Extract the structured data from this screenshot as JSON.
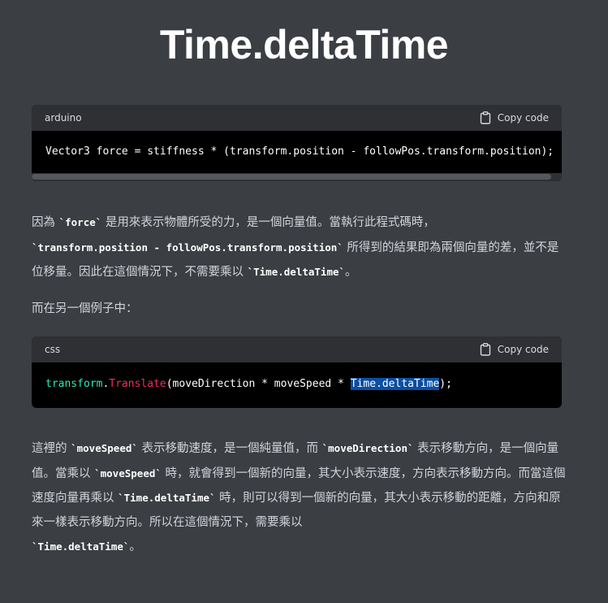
{
  "title": "Time.deltaTime",
  "code_blocks": [
    {
      "language": "arduino",
      "copy_label": "Copy code",
      "code": "Vector3 force = stiffness * (transform.position - followPos.transform.position);"
    },
    {
      "language": "css",
      "copy_label": "Copy code",
      "tokens": {
        "obj": "transform",
        "dot": ".",
        "method": "Translate",
        "args": "(moveDirection * moveSpeed * ",
        "selected": "Time.deltaTime",
        "end": ");"
      }
    }
  ],
  "paragraphs": [
    [
      {
        "t": "因為 "
      },
      {
        "c": "`force`"
      },
      {
        "t": " 是用來表示物體所受的力，是一個向量值。當執行此程式碼時，"
      },
      {
        "br": true
      },
      {
        "c": "`transform.position - followPos.transform.position`"
      },
      {
        "t": " 所得到的結果即為兩個向量的差，並不是位移量。因此在這個情況下，不需要乘以 "
      },
      {
        "c": "`Time.deltaTime`"
      },
      {
        "t": "。"
      }
    ],
    [
      {
        "t": "而在另一個例子中："
      }
    ],
    [
      {
        "t": "這裡的 "
      },
      {
        "c": "`moveSpeed`"
      },
      {
        "t": " 表示移動速度，是一個純量值，而 "
      },
      {
        "c": "`moveDirection`"
      },
      {
        "t": " 表示移動方向，是一個向量值。當乘以 "
      },
      {
        "c": "`moveSpeed`"
      },
      {
        "t": " 時，就會得到一個新的向量，其大小表示速度，方向表示移動方向。而當這個速度向量再乘以 "
      },
      {
        "c": "`Time.deltaTime`"
      },
      {
        "t": " 時，則可以得到一個新的向量，其大小表示移動的距離，方向和原來一樣表示移動方向。所以在這個情況下，需要乘以"
      },
      {
        "br": true
      },
      {
        "c": "`Time.deltaTime`"
      },
      {
        "t": "。"
      }
    ]
  ]
}
